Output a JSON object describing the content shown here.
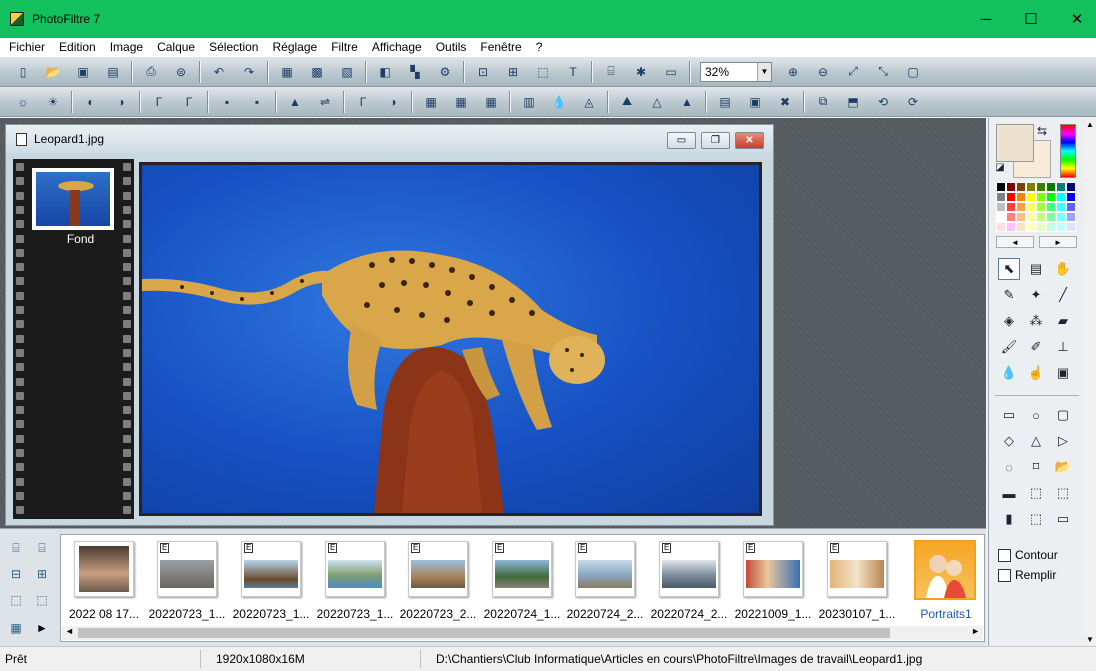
{
  "window": {
    "title": "PhotoFiltre 7",
    "minimize_glyph": "─",
    "maximize_glyph": "☐",
    "close_glyph": "✕"
  },
  "menu": [
    "Fichier",
    "Edition",
    "Image",
    "Calque",
    "Sélection",
    "Réglage",
    "Filtre",
    "Affichage",
    "Outils",
    "Fenêtre",
    "?"
  ],
  "toolbar": {
    "zoom_value": "32%"
  },
  "document": {
    "title": "Leopard1.jpg",
    "layer_label": "Fond",
    "min_glyph": "▭",
    "max_glyph": "❐",
    "close_glyph": "✕"
  },
  "colors": {
    "foreground": "#ebe1cc",
    "background": "#f6ecd8",
    "titlebar": "#12c05e"
  },
  "options": {
    "contour_label": "Contour",
    "remplir_label": "Remplir"
  },
  "explorer": {
    "thumbnails": [
      {
        "label": "2022 08 17...",
        "tag": ""
      },
      {
        "label": "20220723_1...",
        "tag": "E"
      },
      {
        "label": "20220723_1...",
        "tag": "E"
      },
      {
        "label": "20220723_1...",
        "tag": "E"
      },
      {
        "label": "20220723_2...",
        "tag": "E"
      },
      {
        "label": "20220724_1...",
        "tag": "E"
      },
      {
        "label": "20220724_2...",
        "tag": "E"
      },
      {
        "label": "20220724_2...",
        "tag": "E"
      },
      {
        "label": "20221009_1...",
        "tag": "E"
      },
      {
        "label": "20230107_1...",
        "tag": "E"
      }
    ],
    "folder_label": "Portraits1"
  },
  "status": {
    "state": "Prêt",
    "dimensions": "1920x1080x16M",
    "path": "D:\\Chantiers\\Club Informatique\\Articles en cours\\PhotoFiltre\\Images de travail\\Leopard1.jpg"
  }
}
